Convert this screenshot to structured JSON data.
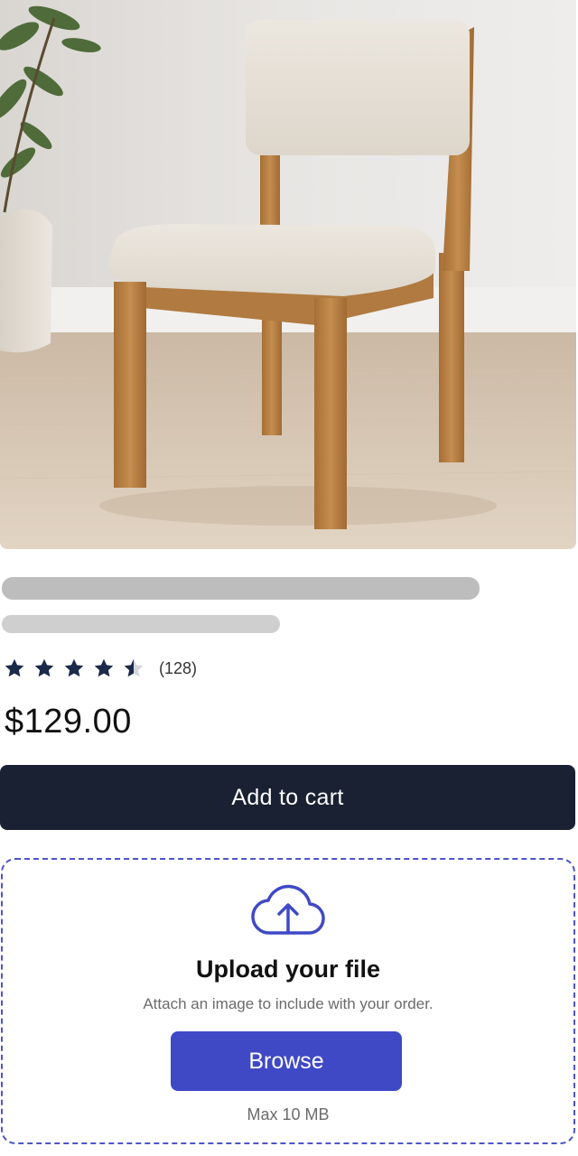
{
  "product": {
    "image_alt": "Upholstered wooden dining chair",
    "rating": {
      "stars": 4.5,
      "max_stars": 5,
      "count_label": "(128)"
    },
    "price": "$129.00",
    "add_to_cart_label": "Add to cart"
  },
  "upload": {
    "icon": "cloud-upload-icon",
    "title": "Upload your file",
    "description": "Attach an image to include with your order.",
    "browse_label": "Browse",
    "max_size_label": "Max 10 MB"
  },
  "colors": {
    "primary_dark": "#1a2132",
    "accent": "#3f49c6",
    "star": "#1c2a4a",
    "skeleton": "#bdbdbd"
  }
}
